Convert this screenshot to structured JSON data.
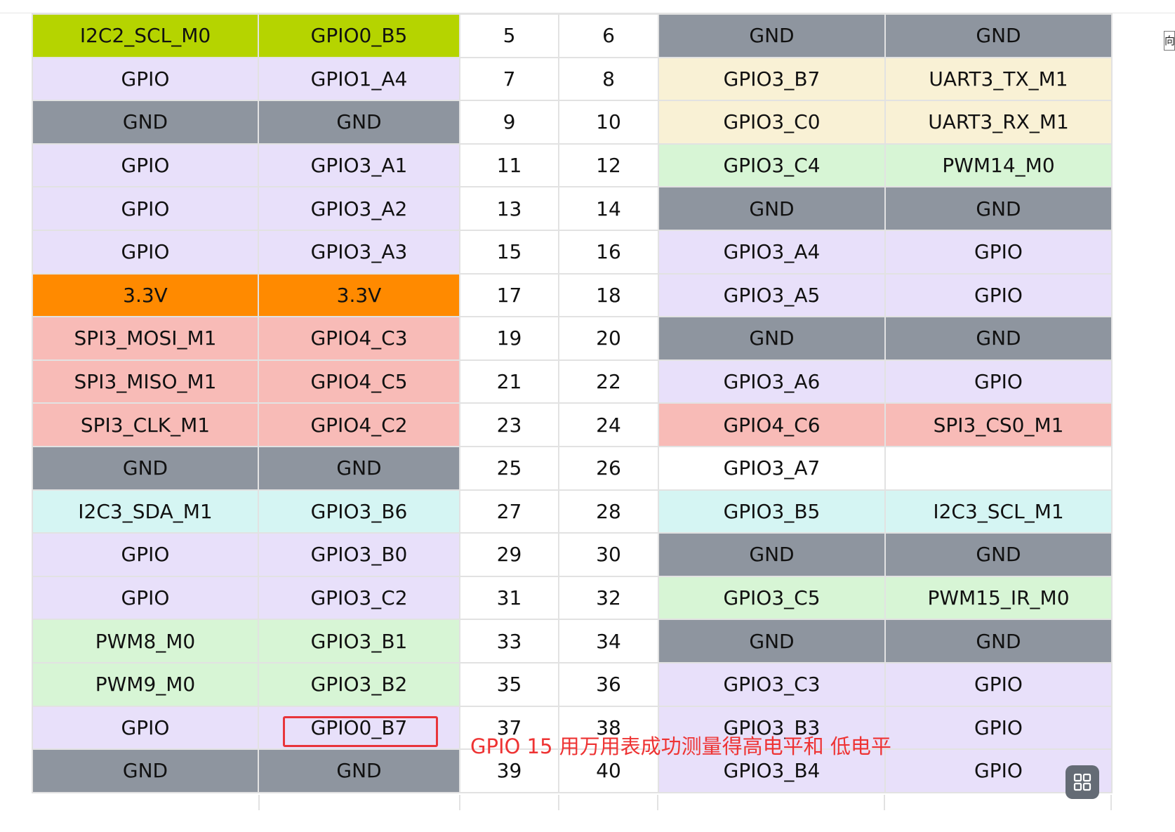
{
  "table": {
    "rows": [
      {
        "l_func": "I2C2_SCL_M0",
        "l_gpio": "GPIO0_B5",
        "odd": "5",
        "even": "6",
        "r_gpio": "GND",
        "r_func": "GND",
        "lc": "y",
        "rc": "g"
      },
      {
        "l_func": "GPIO",
        "l_gpio": "GPIO1_A4",
        "odd": "7",
        "even": "8",
        "r_gpio": "GPIO3_B7",
        "r_func": "UART3_TX_M1",
        "lc": "p",
        "rc": "c"
      },
      {
        "l_func": "GND",
        "l_gpio": "GND",
        "odd": "9",
        "even": "10",
        "r_gpio": "GPIO3_C0",
        "r_func": "UART3_RX_M1",
        "lc": "g",
        "rc": "c"
      },
      {
        "l_func": "GPIO",
        "l_gpio": "GPIO3_A1",
        "odd": "11",
        "even": "12",
        "r_gpio": "GPIO3_C4",
        "r_func": "PWM14_M0",
        "lc": "p",
        "rc": "l"
      },
      {
        "l_func": "GPIO",
        "l_gpio": "GPIO3_A2",
        "odd": "13",
        "even": "14",
        "r_gpio": "GND",
        "r_func": "GND",
        "lc": "p",
        "rc": "g"
      },
      {
        "l_func": "GPIO",
        "l_gpio": "GPIO3_A3",
        "odd": "15",
        "even": "16",
        "r_gpio": "GPIO3_A4",
        "r_func": "GPIO",
        "lc": "p",
        "rc": "p"
      },
      {
        "l_func": "3.3V",
        "l_gpio": "3.3V",
        "odd": "17",
        "even": "18",
        "r_gpio": "GPIO3_A5",
        "r_func": "GPIO",
        "lc": "o",
        "rc": "p"
      },
      {
        "l_func": "SPI3_MOSI_M1",
        "l_gpio": "GPIO4_C3",
        "odd": "19",
        "even": "20",
        "r_gpio": "GND",
        "r_func": "GND",
        "lc": "r",
        "rc": "g"
      },
      {
        "l_func": "SPI3_MISO_M1",
        "l_gpio": "GPIO4_C5",
        "odd": "21",
        "even": "22",
        "r_gpio": "GPIO3_A6",
        "r_func": "GPIO",
        "lc": "r",
        "rc": "p"
      },
      {
        "l_func": "SPI3_CLK_M1",
        "l_gpio": "GPIO4_C2",
        "odd": "23",
        "even": "24",
        "r_gpio": "GPIO4_C6",
        "r_func": "SPI3_CS0_M1",
        "lc": "r",
        "rc": "r"
      },
      {
        "l_func": "GND",
        "l_gpio": "GND",
        "odd": "25",
        "even": "26",
        "r_gpio": "GPIO3_A7",
        "r_func": "",
        "lc": "g",
        "rc": "w"
      },
      {
        "l_func": "I2C3_SDA_M1",
        "l_gpio": "GPIO3_B6",
        "odd": "27",
        "even": "28",
        "r_gpio": "GPIO3_B5",
        "r_func": "I2C3_SCL_M1",
        "lc": "a",
        "rc": "a"
      },
      {
        "l_func": "GPIO",
        "l_gpio": "GPIO3_B0",
        "odd": "29",
        "even": "30",
        "r_gpio": "GND",
        "r_func": "GND",
        "lc": "p",
        "rc": "g"
      },
      {
        "l_func": "GPIO",
        "l_gpio": "GPIO3_C2",
        "odd": "31",
        "even": "32",
        "r_gpio": "GPIO3_C5",
        "r_func": "PWM15_IR_M0",
        "lc": "p",
        "rc": "l"
      },
      {
        "l_func": "PWM8_M0",
        "l_gpio": "GPIO3_B1",
        "odd": "33",
        "even": "34",
        "r_gpio": "GND",
        "r_func": "GND",
        "lc": "l",
        "rc": "g"
      },
      {
        "l_func": "PWM9_M0",
        "l_gpio": "GPIO3_B2",
        "odd": "35",
        "even": "36",
        "r_gpio": "GPIO3_C3",
        "r_func": "GPIO",
        "lc": "l",
        "rc": "p"
      },
      {
        "l_func": "GPIO",
        "l_gpio": "GPIO0_B7",
        "odd": "37",
        "even": "38",
        "r_gpio": "GPIO3_B3",
        "r_func": "GPIO",
        "lc": "p",
        "rc": "p"
      },
      {
        "l_func": "GND",
        "l_gpio": "GND",
        "odd": "39",
        "even": "40",
        "r_gpio": "GPIO3_B4",
        "r_func": "GPIO",
        "lc": "g",
        "rc": "p"
      }
    ]
  },
  "annotation": {
    "text": "GPIO 15 用万用表成功测量得高电平和 低电平",
    "highlight_color": "#e8353a"
  },
  "side_box_char": "向",
  "floating_button": {
    "icon": "grid-icon"
  },
  "colors": {
    "y": "#b5d400",
    "g": "#8e959f",
    "p": "#e8e0fa",
    "c": "#f9f1d5",
    "l": "#d7f5d5",
    "o": "#ff8a00",
    "r": "#f8bbb7",
    "a": "#d5f5f3",
    "w": "#ffffff"
  }
}
